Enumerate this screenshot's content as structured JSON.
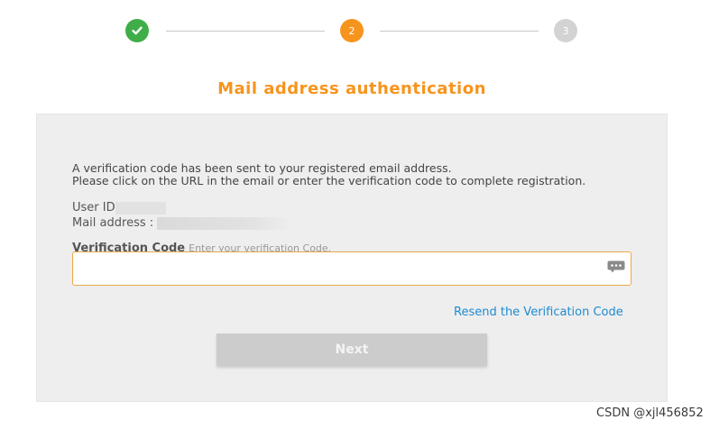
{
  "stepper": {
    "steps": [
      {
        "label": "",
        "state": "complete",
        "color": "#3fae49"
      },
      {
        "label": "2",
        "state": "current",
        "color": "#f7941d"
      },
      {
        "label": "3",
        "state": "upcoming",
        "color": "#d3d3d3"
      }
    ]
  },
  "page": {
    "title": "Mail address authentication",
    "accent_color": "#f7941d"
  },
  "info": {
    "line1": "A verification code has been sent to your registered email address.",
    "line2": "Please click on the URL in the email or enter the verification code to complete registration."
  },
  "fields": {
    "user_id_label": "User ID",
    "mail_label": "Mail address :"
  },
  "verification": {
    "label": "Verification Code",
    "hint": "Enter your verification Code.",
    "value": "",
    "icon": "password-key-icon"
  },
  "actions": {
    "resend_label": "Resend the Verification Code",
    "next_label": "Next",
    "link_color": "#1e8bd1"
  },
  "watermark": "CSDN @xjl456852"
}
